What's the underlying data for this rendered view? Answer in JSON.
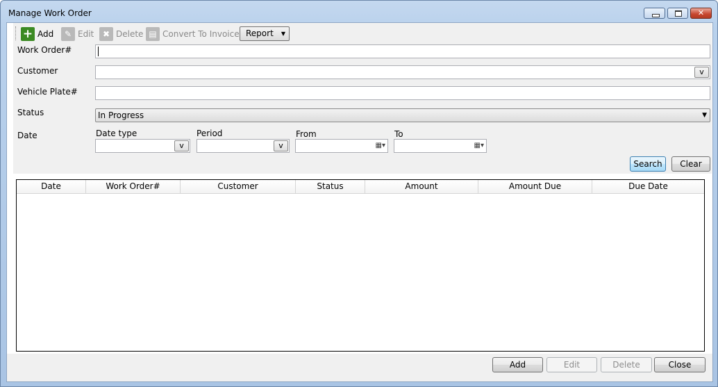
{
  "window": {
    "title": "Manage Work Order"
  },
  "toolbar": {
    "add_label": "Add",
    "edit_label": "Edit",
    "delete_label": "Delete",
    "convert_label": "Convert To Invoice",
    "report_label": "Report"
  },
  "form": {
    "work_order_label": "Work Order#",
    "work_order_value": "",
    "customer_label": "Customer",
    "customer_value": "",
    "customer_btn": "v",
    "vehicle_label": "Vehicle Plate#",
    "vehicle_value": "",
    "status_label": "Status",
    "status_value": "In Progress",
    "date_label": "Date",
    "date_type_label": "Date type",
    "period_label": "Period",
    "from_label": "From",
    "to_label": "To",
    "date_type_btn": "v",
    "period_btn": "v",
    "search_label": "Search",
    "clear_label": "Clear"
  },
  "grid": {
    "columns": [
      "Date",
      "Work Order#",
      "Customer",
      "Status",
      "Amount",
      "Amount Due",
      "Due Date"
    ],
    "rows": []
  },
  "footer": {
    "add_label": "Add",
    "edit_label": "Edit",
    "delete_label": "Delete",
    "close_label": "Close"
  },
  "icons": {
    "add": "plus-icon",
    "edit": "pencil-icon",
    "delete": "x-icon",
    "convert": "document-icon",
    "calendar": "calendar-icon"
  },
  "colors": {
    "add_icon": "#3b8a23",
    "focus_border": "#3c7fb1"
  }
}
